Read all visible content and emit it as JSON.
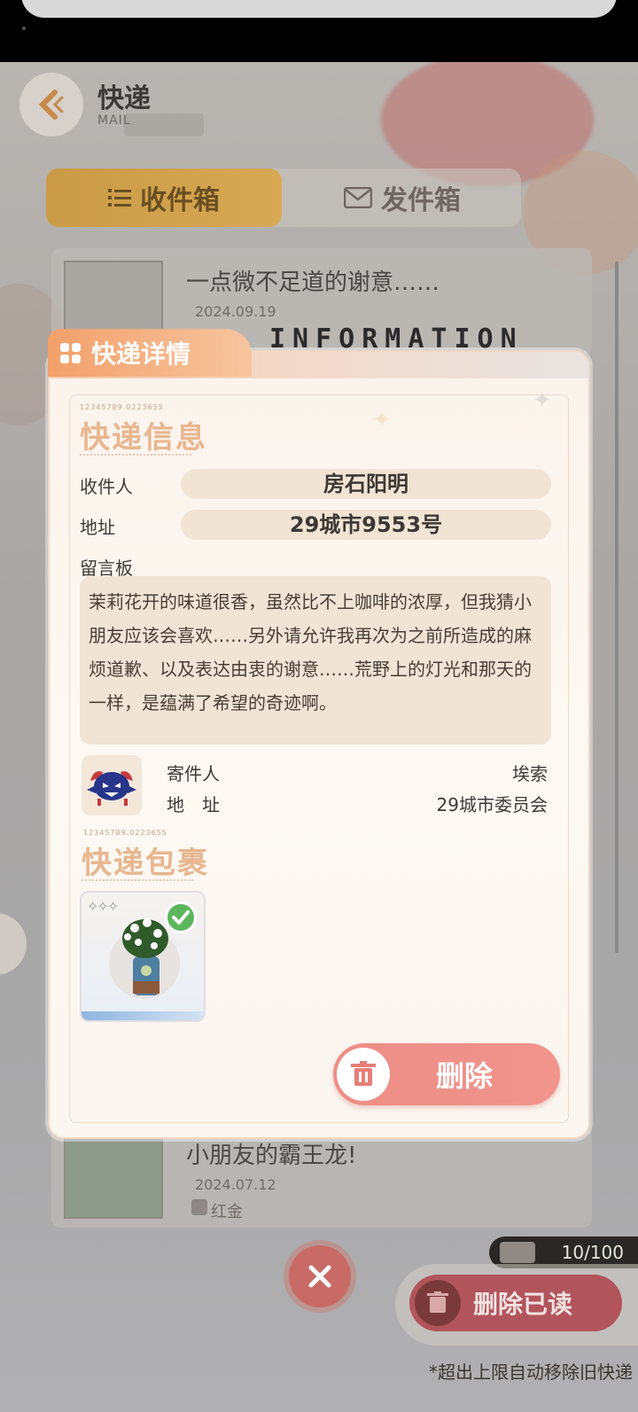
{
  "app": {
    "title": "快递",
    "subtitle": "MAIL",
    "tabs": [
      {
        "label": "收件箱",
        "active": true
      },
      {
        "label": "发件箱",
        "active": false
      }
    ]
  },
  "mail_list": [
    {
      "title": "一点微不足道的谢意……",
      "date": "2024.09.19"
    },
    {
      "title": "小朋友的霸王龙!",
      "date": "2024.07.12",
      "sender": "红金"
    }
  ],
  "mailbox_count": "10/100",
  "delete_read_label": "删除已读",
  "footnote": "*超出上限自动移除旧快递",
  "modal": {
    "tab_title": "快递详情",
    "watermark": "INFORMATION",
    "barcode": "12345789.0223655",
    "info_section_title": "快递信息",
    "recipient_label": "收件人",
    "recipient_value": "房石阳明",
    "address_label": "地址",
    "address_value": "29城市9553号",
    "message_label": "留言板",
    "message_text": "茉莉花开的味道很香，虽然比不上咖啡的浓厚，但我猜小朋友应该会喜欢……另外请允许我再次为之前所造成的麻烦道歉、以及表达由衷的谢意……荒野上的灯光和那天的一样，是蕴满了希望的奇迹啊。",
    "sender_label": "寄件人",
    "sender_value": "埃索",
    "sender_address_label": "地　址",
    "sender_address_value": "29城市委员会",
    "package_section_title": "快递包裹",
    "delete_label": "删除"
  },
  "colors": {
    "accent_orange": "#f2a06a",
    "delete_red": "#ee8d86",
    "field_bg": "#f1e4d5",
    "section_title": "#e8b68f"
  }
}
